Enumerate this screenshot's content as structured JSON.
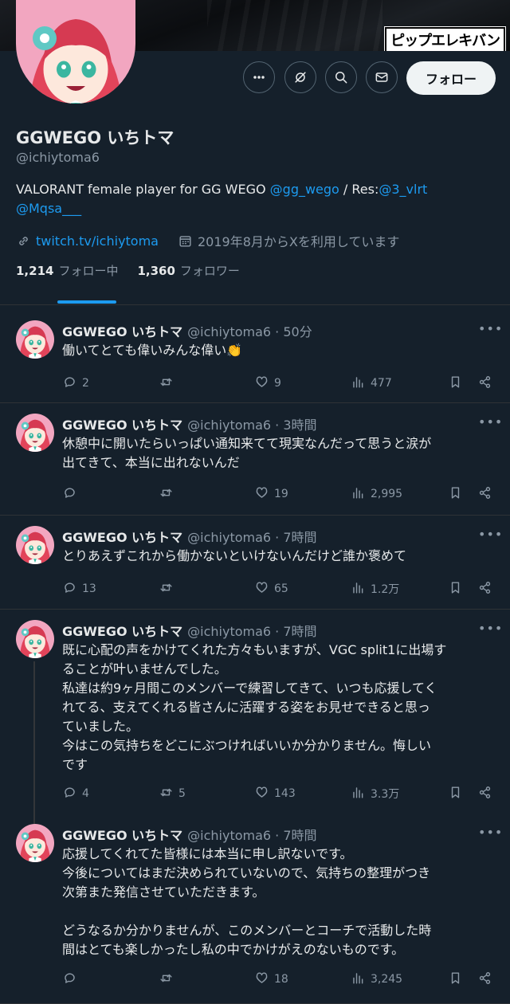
{
  "banner": {
    "watermark": "ピップエレキバン"
  },
  "profile": {
    "name": "GGWEGO いちトマ",
    "handle": "@ichiytoma6",
    "bio_text": "VALORANT female player for GG WEGO ",
    "bio_mention1": "@gg_wego",
    "bio_sep": " / Res:",
    "bio_mention2": "@3_vlrt",
    "bio_mention3": "@Mqsa___",
    "url": "twitch.tv/ichiytoma",
    "joined": "2019年8月からXを利用しています",
    "following_count": "1,214",
    "following_label": "フォロー中",
    "followers_count": "1,360",
    "followers_label": "フォロワー",
    "follow_button": "フォロー"
  },
  "accent_color": "#1d9bf0",
  "tweets": [
    {
      "name": "GGWEGO いちトマ",
      "meta": "@ichiytoma6 · 50分",
      "text": "働いてとても偉いみんな偉い👏",
      "replies": "2",
      "retweets": "",
      "likes": "9",
      "views": "477"
    },
    {
      "name": "GGWEGO いちトマ",
      "meta": "@ichiytoma6 · 3時間",
      "text": "休憩中に開いたらいっぱい通知来てて現実なんだって思うと涙が\n出てきて、本当に出れないんだ",
      "replies": "",
      "retweets": "",
      "likes": "19",
      "views": "2,995"
    },
    {
      "name": "GGWEGO いちトマ",
      "meta": "@ichiytoma6 · 7時間",
      "text": "とりあえずこれから働かないといけないんだけど誰か褒めて",
      "replies": "13",
      "retweets": "",
      "likes": "65",
      "views": "1.2万"
    },
    {
      "name": "GGWEGO いちトマ",
      "meta": "@ichiytoma6 · 7時間",
      "text": "既に心配の声をかけてくれた方々もいますが、VGC split1に出場す\nることが叶いませんでした。\n私達は約9ヶ月間このメンバーで練習してきて、いつも応援してく\nれてる、支えてくれる皆さんに活躍する姿をお見せできると思っ\nていました。\n今はこの気持ちをどこにぶつければいいか分かりません。悔しい\nです",
      "replies": "4",
      "retweets": "5",
      "likes": "143",
      "views": "3.3万"
    },
    {
      "name": "GGWEGO いちトマ",
      "meta": "@ichiytoma6 · 7時間",
      "text": "応援してくれてた皆様には本当に申し訳ないです。\n今後についてはまだ決められていないので、気持ちの整理がつき\n次第また発信させていただきます。\n\nどうなるか分かりませんが、このメンバーとコーチで活動した時\n間はとても楽しかったし私の中でかけがえのないものです。",
      "replies": "",
      "retweets": "",
      "likes": "18",
      "views": "3,245"
    }
  ]
}
